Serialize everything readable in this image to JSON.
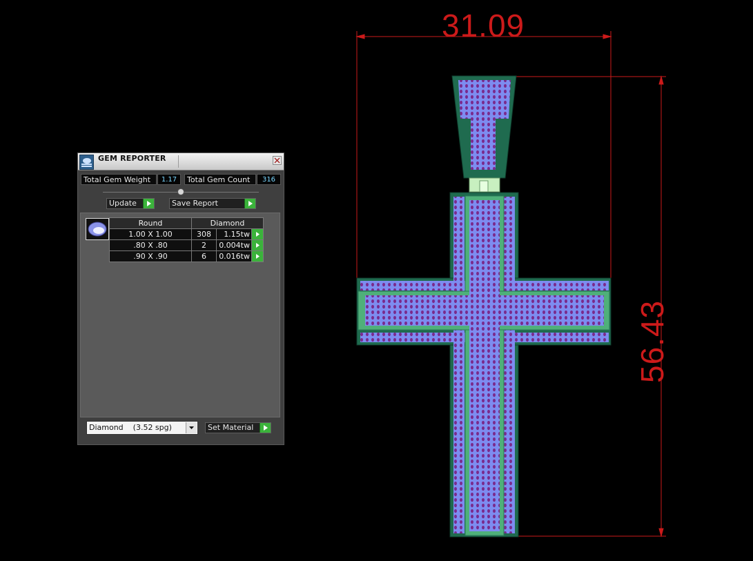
{
  "gem_reporter": {
    "title": "GEM REPORTER",
    "total_gem_weight_label": "Total Gem Weight",
    "total_gem_weight": "1.17",
    "total_gem_count_label": "Total Gem Count",
    "total_gem_count": "316",
    "update_label": "Update",
    "save_report_label": "Save Report",
    "table": {
      "shape_header": "Round",
      "material_header": "Diamond",
      "rows": [
        {
          "size": "1.00 X 1.00",
          "count": "308",
          "weight": "1.15tw"
        },
        {
          "size": ".80 X .80",
          "count": "2",
          "weight": "0.004tw"
        },
        {
          "size": ".90 X .90",
          "count": "6",
          "weight": "0.016tw"
        }
      ]
    },
    "material_selected": "Diamond    (3.52 spg)",
    "set_material_label": "Set Material"
  },
  "dimensions": {
    "width": "31.09",
    "height": "56.43"
  },
  "colors": {
    "dimension": "#cc1a1a",
    "metal_dark": "#1f6b4f",
    "metal_light": "#4fb07a",
    "gem_fill": "#7d8cf0",
    "gem_dot": "#7a2a8c",
    "go_button": "#3bb33b"
  }
}
